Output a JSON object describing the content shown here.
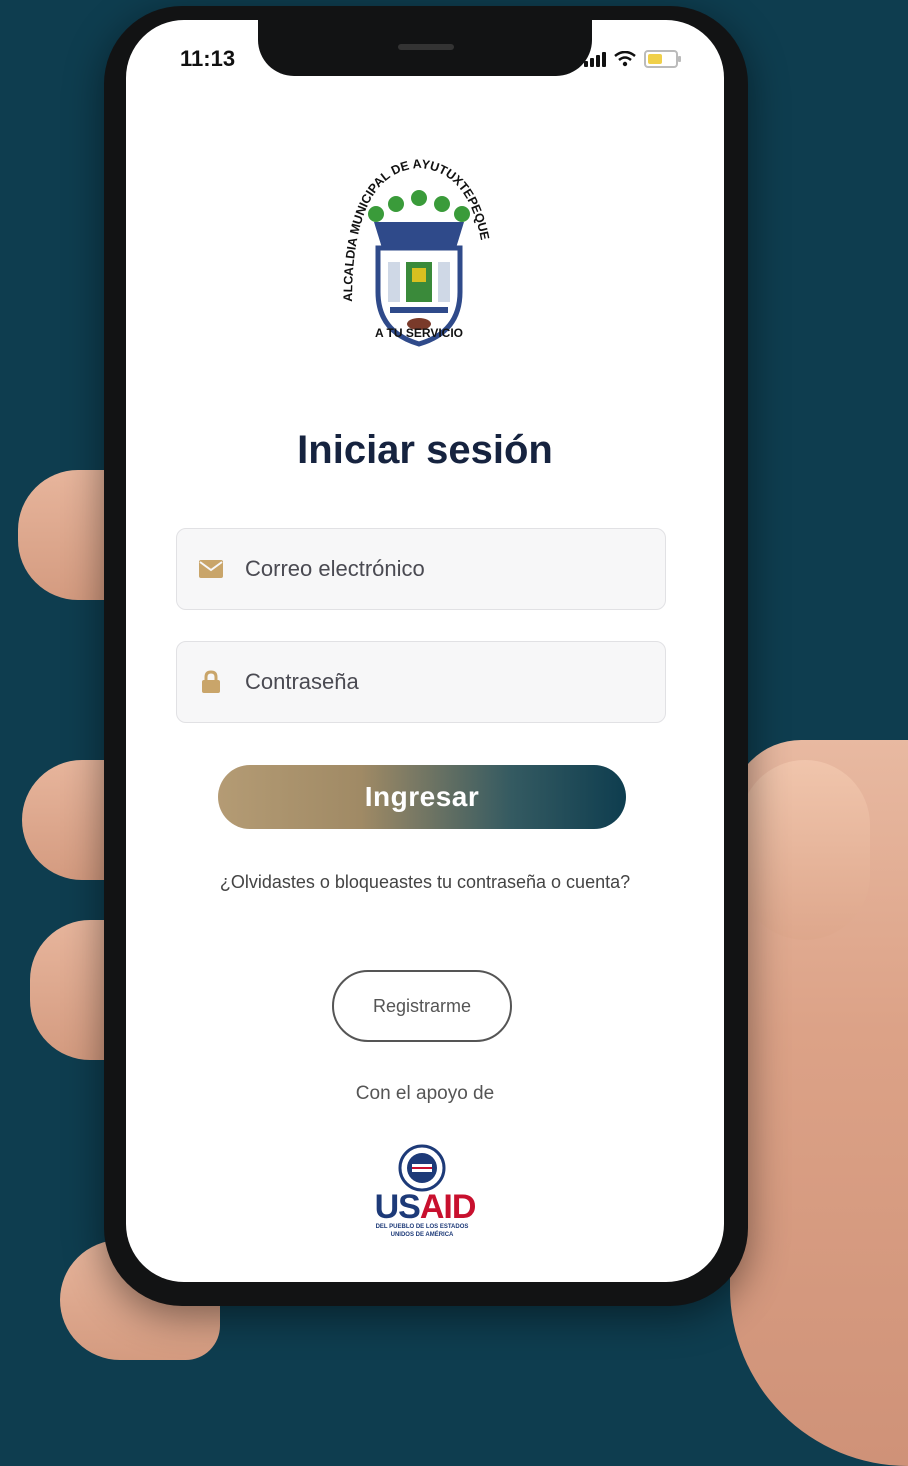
{
  "status_bar": {
    "time": "11:13"
  },
  "logo": {
    "arc_text": "ALCALDIA MUNICIPAL DE AYUTUXTEPEQUE",
    "caption": "A TU SERVICIO"
  },
  "title": "Iniciar sesión",
  "email_field": {
    "placeholder": "Correo electrónico"
  },
  "password_field": {
    "placeholder": "Contraseña"
  },
  "login_button": {
    "label": "Ingresar"
  },
  "forgot_link": {
    "label": "¿Olvidastes o bloqueastes tu contraseña o cuenta?"
  },
  "register_button": {
    "label": "Registrarme"
  },
  "support_text": "Con el apoyo de",
  "sponsor": {
    "logo_us": "US",
    "logo_aid": "AID",
    "tagline": "DEL PUEBLO DE LOS ESTADOS UNIDOS DE AMÉRICA"
  },
  "colors": {
    "background": "#0e3d4f",
    "title": "#16233f",
    "button_gradient_start": "#b49b74",
    "button_gradient_end": "#0e3d4f",
    "icon_gold": "#c9a56a",
    "usaid_blue": "#1d3a78",
    "usaid_red": "#c8102e"
  }
}
